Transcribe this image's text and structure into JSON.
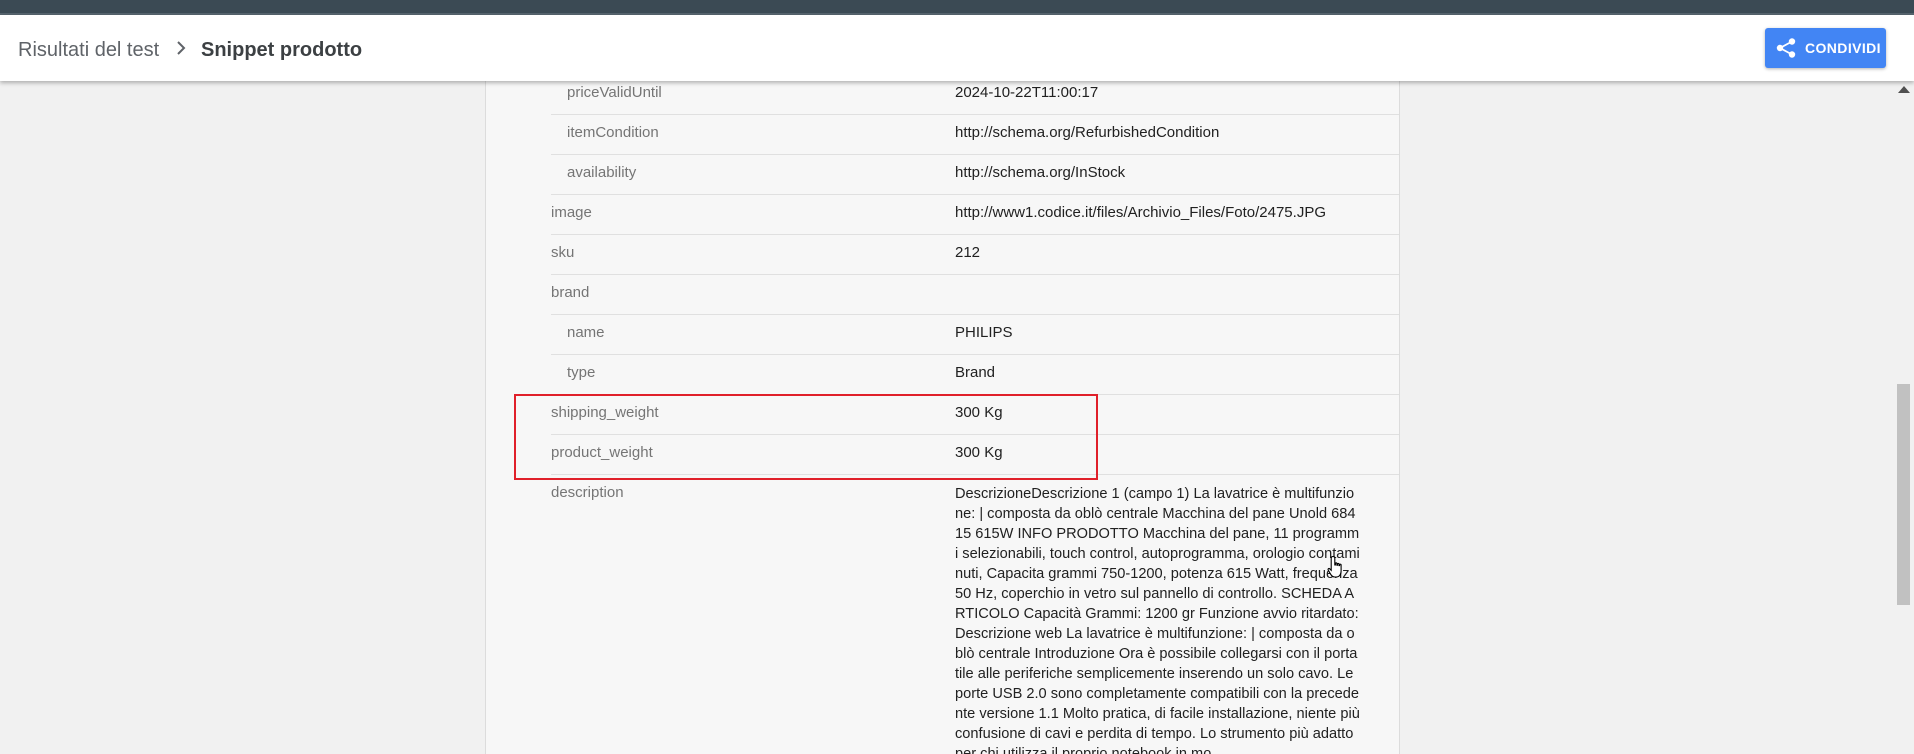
{
  "header": {
    "breadcrumb_root": "Risultati del test",
    "breadcrumb_current": "Snippet prodotto",
    "share_label": "CONDIVIDI"
  },
  "rows": [
    {
      "key": "priceValidUntil",
      "value": "2024-10-22T11:00:17"
    },
    {
      "key": "itemCondition",
      "value": "http://schema.org/RefurbishedCondition"
    },
    {
      "key": "availability",
      "value": "http://schema.org/InStock"
    },
    {
      "key": "image",
      "value": "http://www1.codice.it/files/Archivio_Files/Foto/2475.JPG"
    },
    {
      "key": "sku",
      "value": "212"
    },
    {
      "key": "brand",
      "value": ""
    },
    {
      "key": "name",
      "value": "PHILIPS"
    },
    {
      "key": "type",
      "value": "Brand"
    },
    {
      "key": "shipping_weight",
      "value": "300 Kg"
    },
    {
      "key": "product_weight",
      "value": "300 Kg"
    },
    {
      "key": "description",
      "value": "DescrizioneDescrizione 1 (campo 1) La lavatrice è multifunzione: | composta da oblò centrale Macchina del pane Unold 68415 615W INFO PRODOTTO Macchina del pane, 11 programmi selezionabili, touch control, autoprogramma, orologio contaminuti, Capacita grammi 750-1200, potenza 615 Watt, frequenza 50 Hz, coperchio in vetro sul pannello di controllo. SCHEDA ARTICOLO Capacità Grammi: 1200 gr Funzione avvio ritardato:Descrizione web La lavatrice è multifunzione: | composta da oblò centrale Introduzione Ora è possibile collegarsi con il portatile alle periferiche semplicemente inserendo un solo cavo. Le porte USB 2.0 sono completamente compatibili con la precedente versione 1.1 Molto pratica, di facile installazione, niente più confusione di cavi e perdita di tempo. Lo strumento più adatto per chi utilizza il proprio notebook in mo"
    }
  ],
  "colors": {
    "accent": "#4285f4",
    "highlight_border": "#e0202a"
  },
  "icons": {
    "breadcrumb_separator": "chevron-right-icon",
    "share": "share-icon",
    "cursor": "hand-pointer-icon"
  }
}
